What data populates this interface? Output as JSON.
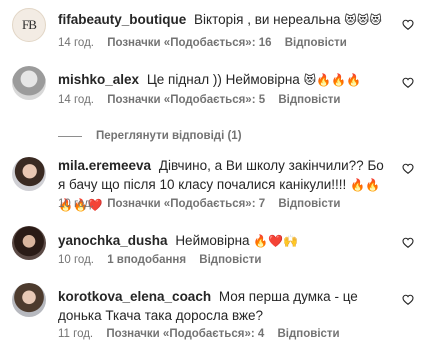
{
  "comments": [
    {
      "username": "fifabeauty_boutique",
      "text": "Вікторія , ви нереальна",
      "emoji": "😻😻😻",
      "time": "14 год.",
      "likes_label": "Позначки «Подобається»: 16",
      "reply_label": "Відповісти",
      "avatar_letters": "FB",
      "liked": false
    },
    {
      "username": "mishko_alex",
      "text": "Це піднал )) Неймовірна",
      "emoji": "😻🔥🔥🔥",
      "time": "14 год.",
      "likes_label": "Позначки «Подобається»: 5",
      "reply_label": "Відповісти",
      "liked": false
    },
    {
      "username": "mila.eremeeva",
      "text": "Дівчино, а Ви школу закінчили?? Бо я бачу що після 10 класу почалися канікули!!!!",
      "emoji": "🔥🔥🔥🔥❤️",
      "time": "10 год.",
      "likes_label": "Позначки «Подобається»: 7",
      "reply_label": "Відповісти",
      "liked": false
    },
    {
      "username": "yanochka_dusha",
      "text": "Неймовірна",
      "emoji": "🔥❤️🙌",
      "time": "10 год.",
      "likes_label": "1 вподобання",
      "reply_label": "Відповісти",
      "liked": false
    },
    {
      "username": "korotkova_elena_coach",
      "text": "Моя перша думка - це донька Ткача така доросла вже?",
      "emoji": "",
      "time": "11 год.",
      "likes_label": "Позначки «Подобається»: 4",
      "reply_label": "Відповісти",
      "liked": false
    }
  ],
  "view_replies_label": "Переглянути відповіді (1)",
  "icons": {
    "like": "heart-outline-icon"
  },
  "colors": {
    "text": "#262626",
    "secondary": "#737373",
    "emoji_fire": "#f2641f",
    "emoji_heart": "#e8235a"
  }
}
